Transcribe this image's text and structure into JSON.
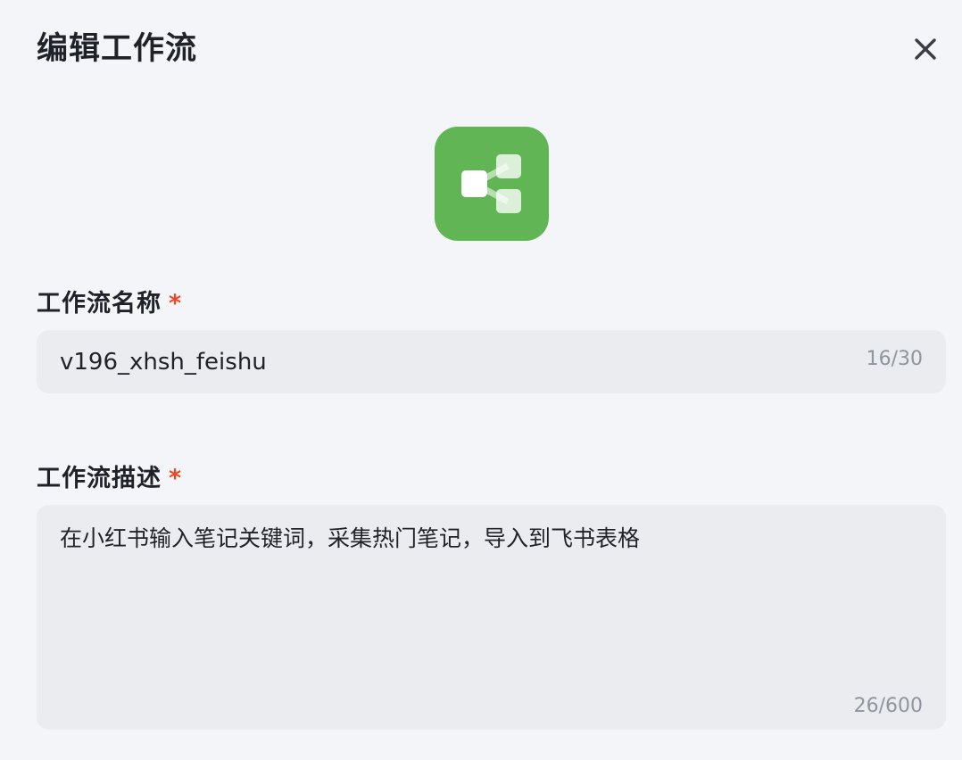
{
  "dialog": {
    "title": "编辑工作流",
    "close_icon": "close-icon",
    "workflow_icon": "workflow-branch-icon",
    "icon_bg_color": "#62b554"
  },
  "name_field": {
    "label": "工作流名称",
    "required_mark": "*",
    "value": "v196_xhsh_feishu",
    "counter": "16/30"
  },
  "description_field": {
    "label": "工作流描述",
    "required_mark": "*",
    "value": "在小红书输入笔记关键词，采集热门笔记，导入到飞书表格",
    "counter": "26/600"
  },
  "colors": {
    "background": "#f4f5f9",
    "input_background": "#ebecf0",
    "required": "#f0461f",
    "counter_text": "#8f959e"
  }
}
